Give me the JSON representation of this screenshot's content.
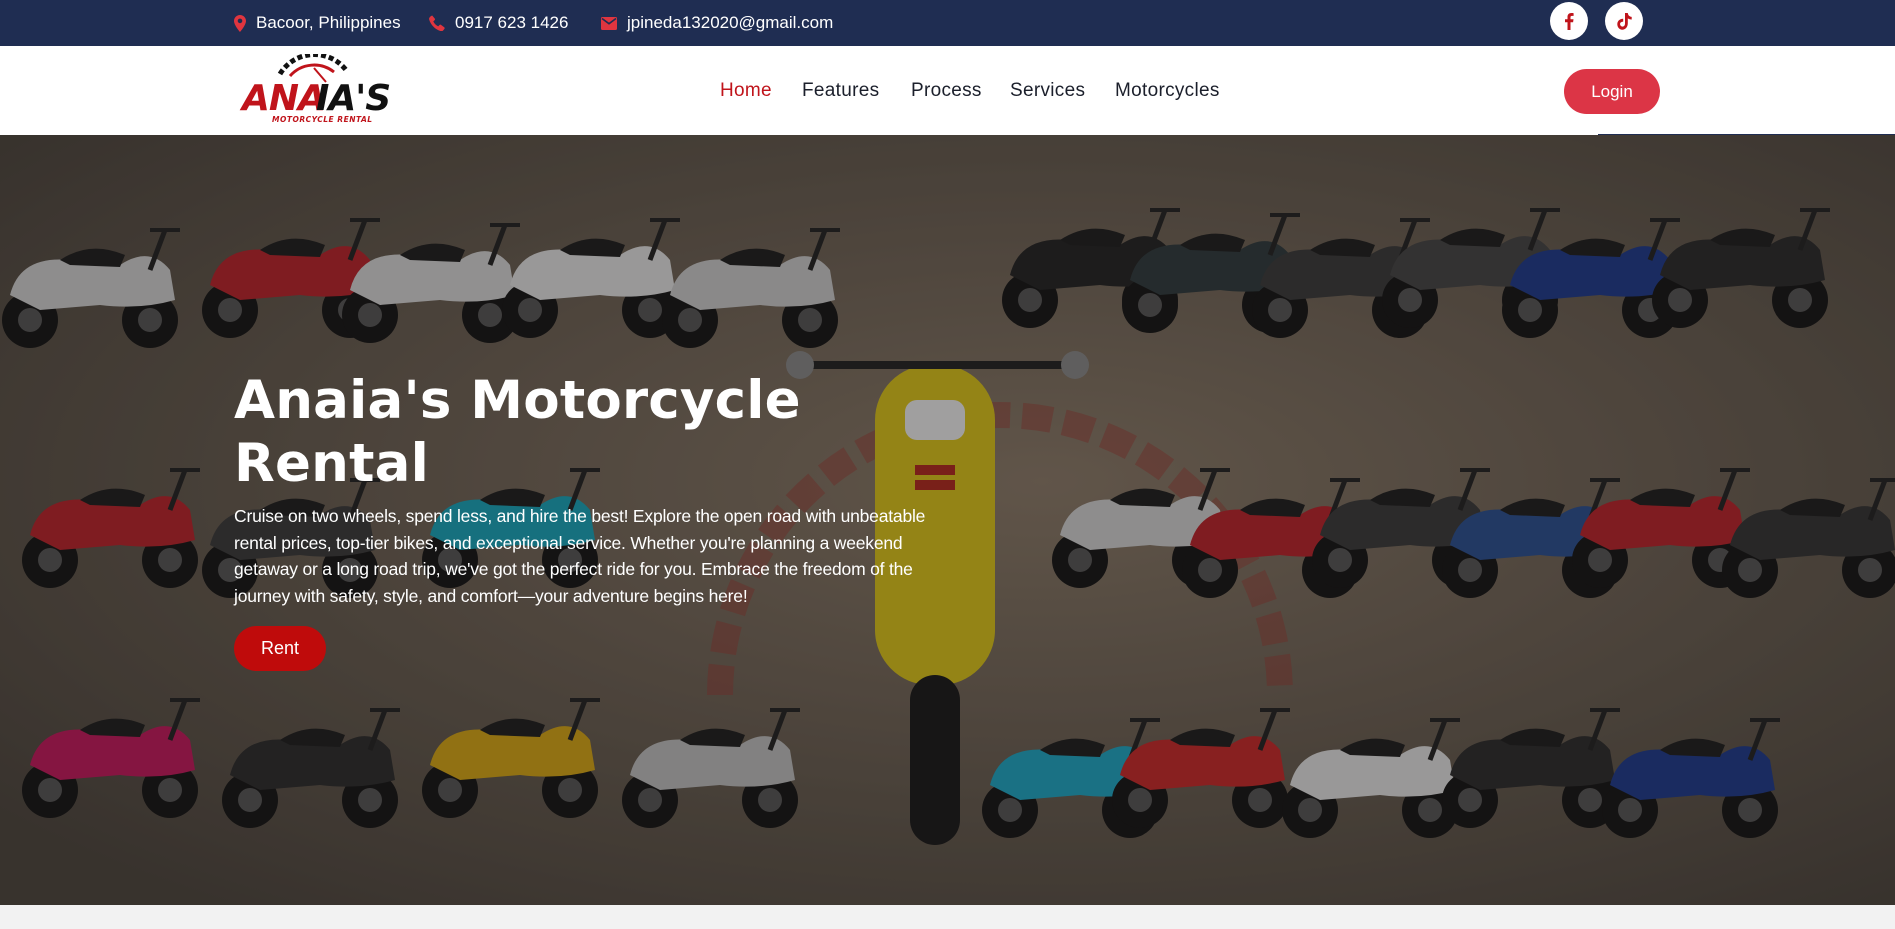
{
  "topbar": {
    "location": "Bacoor, Philippines",
    "phone": "0917 623 1426",
    "email": "jpineda132020@gmail.com",
    "social": [
      "facebook-icon",
      "tiktok-icon"
    ]
  },
  "brand": {
    "name": "ANAIA'S",
    "tagline": "MOTORCYCLE RENTAL"
  },
  "nav": {
    "items": [
      {
        "label": "Home",
        "active": true
      },
      {
        "label": "Features",
        "active": false
      },
      {
        "label": "Process",
        "active": false
      },
      {
        "label": "Services",
        "active": false
      },
      {
        "label": "Motorcycles",
        "active": false
      }
    ],
    "login_label": "Login"
  },
  "hero": {
    "title": "Anaia's Motorcycle Rental",
    "description": "Cruise on two wheels, spend less, and hire the best! Explore the open road with unbeatable rental prices, top-tier bikes, and exceptional service. Whether you're planning a weekend getaway or a long road trip, we've got the perfect ride for you. Embrace the freedom of the journey with safety, style, and comfort—your adventure begins here!",
    "cta_label": "Rent"
  },
  "colors": {
    "topbar_bg": "#1f2d52",
    "accent_red": "#c0141b",
    "login_bg": "#dc3546",
    "rent_bg": "#bf0b0b"
  }
}
